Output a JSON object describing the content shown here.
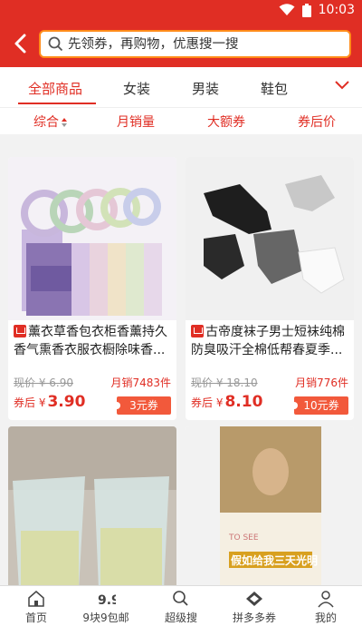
{
  "status_bar": {
    "time": "10:03"
  },
  "header": {
    "search_placeholder": "先领券，再购物，优惠搜一搜"
  },
  "tabs": [
    {
      "label": "全部商品",
      "active": true
    },
    {
      "label": "女装"
    },
    {
      "label": "男装"
    },
    {
      "label": "鞋包"
    }
  ],
  "sort": [
    {
      "label": "综合"
    },
    {
      "label": "月销量"
    },
    {
      "label": "大额券"
    },
    {
      "label": "券后价"
    }
  ],
  "products": [
    {
      "title": "薰衣草香包衣柜香薰持久香气熏香衣服衣橱除味香...",
      "orig_price": "现价 ¥ 6.90",
      "sales": "月销7483件",
      "after_label": "券后 ¥",
      "after_price": "3.90",
      "coupon": "3元券"
    },
    {
      "title": "古帝度袜子男士短袜纯棉防臭吸汗全棉低帮春夏季...",
      "orig_price": "现价 ¥ 18.10",
      "sales": "月销776件",
      "after_label": "券后 ¥",
      "after_price": "8.10",
      "coupon": "10元券"
    },
    {
      "title": ""
    },
    {
      "title": "",
      "book_cover_text": "假如给我三天光明",
      "book_tag": "TO SEE"
    }
  ],
  "nav": [
    {
      "label": "首页",
      "icon": "home-icon"
    },
    {
      "label": "9块9包邮",
      "icon": "nine-nine-icon"
    },
    {
      "label": "超级搜",
      "icon": "search-icon"
    },
    {
      "label": "拼多多券",
      "icon": "pinduoduo-icon"
    },
    {
      "label": "我的",
      "icon": "user-icon"
    }
  ],
  "colors": {
    "brand": "#e02e24",
    "search_border": "#ff8c1a",
    "coupon": "#f2593b"
  }
}
